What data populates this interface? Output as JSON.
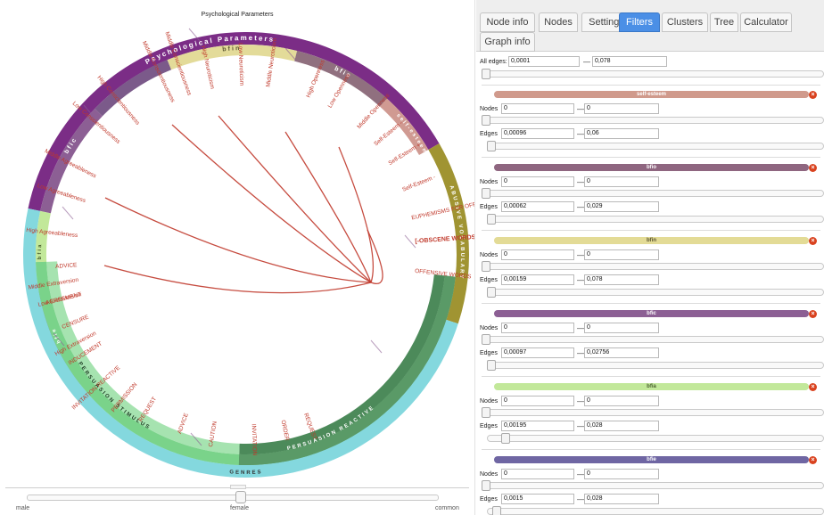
{
  "chart": {
    "title": "Psychological Parameters",
    "ring_outer": [
      {
        "label": "Psychological Parameters",
        "color": "#7b2d86"
      },
      {
        "label": "ABUSIVE VOCABULARY",
        "color": "#a09432"
      },
      {
        "label": "GENRES",
        "color": "#84d8de"
      }
    ],
    "ring_mid": [
      {
        "label": "bfic",
        "color": "#8c5f94"
      },
      {
        "label": "bfin",
        "color": "#e3db99"
      },
      {
        "label": "bfio",
        "color": "#90707f"
      },
      {
        "label": "self-esteem",
        "color": "#d09a92"
      },
      {
        "label": "bfia",
        "color": "#c2e89a"
      },
      {
        "label": "bfie",
        "color": "#736b9e"
      },
      {
        "label": "PERSUASION STIMULUS",
        "color": "#7ad38a"
      },
      {
        "label": "PERSUASION REACTIVE",
        "color": "#5a9a67"
      }
    ],
    "nodes": [
      "Middle Conscientiousness",
      "High Conscientiousness",
      "Low Conscientiousness",
      "Middle Conscientiousness",
      "High Neuroticism",
      "Low Neuroticism",
      "Middle Neuroticism",
      "High Openness",
      "Low Openness",
      "Middle Openness",
      "Self-Esteem -",
      "Self-Esteem +",
      "Self-Esteem -",
      "Middle Agreeableness",
      "Low Agreeableness",
      "High Agreeableness",
      "Middle Extraversion",
      "Low Extraversion",
      "High Extraversion",
      "EUPHEMISMS FOR OFFENSIVE WORDS",
      "[-OBSCENE WORDS-]",
      "OFFENSIVE WORDS",
      "REQUEST",
      "ORDER",
      "INVITATION",
      "CAUTION",
      "ADVICE",
      "REQUEST",
      "PERMISSION",
      "INVITATION REACTIVE",
      "INDUCEMENT",
      "CENSURE",
      "AGREEMENT",
      "ADVICE"
    ],
    "link_color": "#c0392b"
  },
  "bottom_slider": {
    "left_label": "male",
    "mid_label": "female",
    "right_label": "common"
  },
  "tabs": [
    {
      "label": "Node info",
      "active": false
    },
    {
      "label": "Nodes",
      "active": false
    },
    {
      "label": "Settings",
      "active": false
    },
    {
      "label": "Filters",
      "active": true
    },
    {
      "label": "Clusters",
      "active": false
    },
    {
      "label": "Tree",
      "active": false
    },
    {
      "label": "Calculator",
      "active": false
    },
    {
      "label": "Graph info",
      "active": false
    }
  ],
  "filters": {
    "all_edges_label": "All edges:",
    "all_edges_min": "0,0001",
    "all_edges_max": "0,078",
    "nodes_label": "Nodes",
    "edges_label": "Edges",
    "dash": "—",
    "groups": [
      {
        "name": "self-esteem",
        "color": "#d09a8c",
        "nodes_min": "0",
        "nodes_max": "0",
        "edges_min": "0,00096",
        "edges_max": "0,06"
      },
      {
        "name": "bfio",
        "color": "#8f6680",
        "nodes_min": "0",
        "nodes_max": "0",
        "edges_min": "0,00062",
        "edges_max": "0,029"
      },
      {
        "name": "bfin",
        "color": "#e3db96",
        "nodes_min": "0",
        "nodes_max": "0",
        "edges_min": "0,00159",
        "edges_max": "0,078"
      },
      {
        "name": "bfic",
        "color": "#8c5f94",
        "nodes_min": "0",
        "nodes_max": "0",
        "edges_min": "0,00097",
        "edges_max": "0,02756"
      },
      {
        "name": "bfia",
        "color": "#c2e89a",
        "nodes_min": "0",
        "nodes_max": "0",
        "edges_min": "0,00195",
        "edges_max": "0,028"
      },
      {
        "name": "bfie",
        "color": "#6f66a3",
        "nodes_min": "0",
        "nodes_max": "0",
        "edges_min": "0,0015",
        "edges_max": "0,028"
      }
    ],
    "close_glyph": "×"
  }
}
